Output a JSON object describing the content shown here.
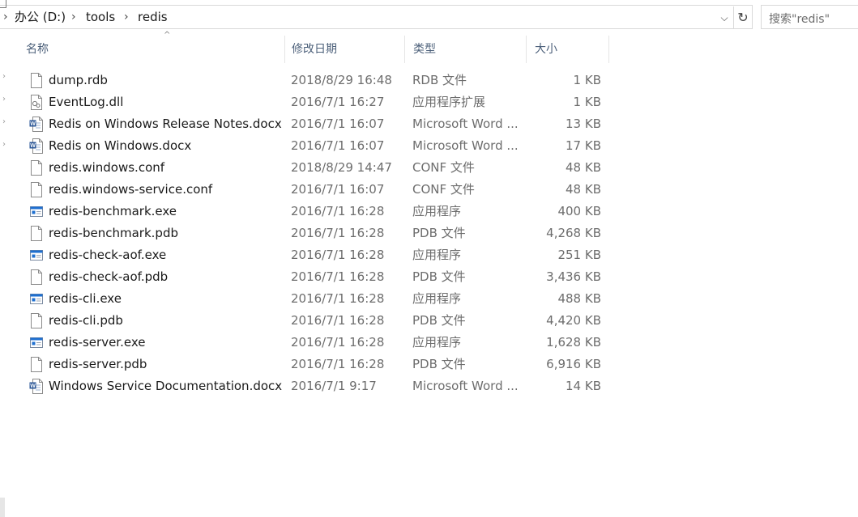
{
  "address_bar": {
    "breadcrumbs": [
      {
        "label": "办公 (D:)"
      },
      {
        "label": "tools"
      },
      {
        "label": "redis"
      }
    ],
    "search_placeholder": "搜索\"redis\""
  },
  "columns": {
    "name": "名称",
    "date": "修改日期",
    "type": "类型",
    "size": "大小"
  },
  "files": [
    {
      "name": "dump.rdb",
      "date": "2018/8/29 16:48",
      "type": "RDB 文件",
      "size": "1 KB",
      "icon": "file-icon"
    },
    {
      "name": "EventLog.dll",
      "date": "2016/7/1 16:27",
      "type": "应用程序扩展",
      "size": "1 KB",
      "icon": "dll-icon"
    },
    {
      "name": "Redis on Windows Release Notes.docx",
      "date": "2016/7/1 16:07",
      "type": "Microsoft Word ...",
      "size": "13 KB",
      "icon": "word-doc-icon"
    },
    {
      "name": "Redis on Windows.docx",
      "date": "2016/7/1 16:07",
      "type": "Microsoft Word ...",
      "size": "17 KB",
      "icon": "word-doc-icon"
    },
    {
      "name": "redis.windows.conf",
      "date": "2018/8/29 14:47",
      "type": "CONF 文件",
      "size": "48 KB",
      "icon": "file-icon"
    },
    {
      "name": "redis.windows-service.conf",
      "date": "2016/7/1 16:07",
      "type": "CONF 文件",
      "size": "48 KB",
      "icon": "file-icon"
    },
    {
      "name": "redis-benchmark.exe",
      "date": "2016/7/1 16:28",
      "type": "应用程序",
      "size": "400 KB",
      "icon": "exe-icon"
    },
    {
      "name": "redis-benchmark.pdb",
      "date": "2016/7/1 16:28",
      "type": "PDB 文件",
      "size": "4,268 KB",
      "icon": "file-icon"
    },
    {
      "name": "redis-check-aof.exe",
      "date": "2016/7/1 16:28",
      "type": "应用程序",
      "size": "251 KB",
      "icon": "exe-icon"
    },
    {
      "name": "redis-check-aof.pdb",
      "date": "2016/7/1 16:28",
      "type": "PDB 文件",
      "size": "3,436 KB",
      "icon": "file-icon"
    },
    {
      "name": "redis-cli.exe",
      "date": "2016/7/1 16:28",
      "type": "应用程序",
      "size": "488 KB",
      "icon": "exe-icon"
    },
    {
      "name": "redis-cli.pdb",
      "date": "2016/7/1 16:28",
      "type": "PDB 文件",
      "size": "4,420 KB",
      "icon": "file-icon"
    },
    {
      "name": "redis-server.exe",
      "date": "2016/7/1 16:28",
      "type": "应用程序",
      "size": "1,628 KB",
      "icon": "exe-icon"
    },
    {
      "name": "redis-server.pdb",
      "date": "2016/7/1 16:28",
      "type": "PDB 文件",
      "size": "6,916 KB",
      "icon": "file-icon"
    },
    {
      "name": "Windows Service Documentation.docx",
      "date": "2016/7/1 9:17",
      "type": "Microsoft Word ...",
      "size": "14 KB",
      "icon": "word-doc-icon"
    }
  ],
  "colors": {
    "header_text": "#4c607a",
    "secondary_text": "#6d6d6d",
    "exe_blue": "#1e6fd0",
    "word_blue": "#2b5797"
  }
}
